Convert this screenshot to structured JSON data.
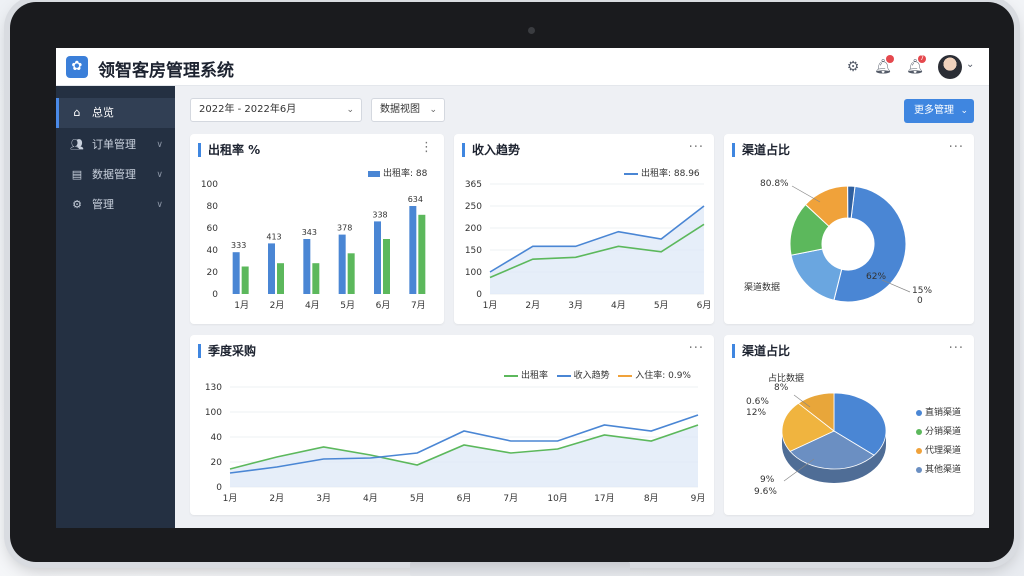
{
  "app": {
    "title": "领智客房管理系统",
    "logo_icon": "tree-logo-icon"
  },
  "topbar": {
    "icons": [
      "settings-icon",
      "bell-icon",
      "notification-icon"
    ],
    "badge_count": "7"
  },
  "sidebar": {
    "items": [
      {
        "label": "总览",
        "icon": "home-icon",
        "active": true
      },
      {
        "label": "订单管理",
        "icon": "users-icon",
        "active": false
      },
      {
        "label": "数据管理",
        "icon": "database-icon",
        "active": false
      },
      {
        "label": "管理",
        "icon": "gear-icon",
        "active": false
      }
    ]
  },
  "filters": {
    "date_range": "2022年 - 2022年6月",
    "view_select": "数据视图",
    "primary_button": "更多管理"
  },
  "cards": {
    "occupancy": {
      "title": "出租率 %",
      "legend": "出租率: 88"
    },
    "revenue": {
      "title": "收入趋势",
      "legend": "出租率: 88.96"
    },
    "channel_top": {
      "title": "渠道占比",
      "label_a": "80.8%",
      "label_b": "62%",
      "label_c": "15%",
      "label_c2": "0",
      "label_d": "渠道数据"
    },
    "quarterly": {
      "title": "季度采购",
      "legend_a": "出租率",
      "legend_b": "收入趋势",
      "legend_c": "入住率: 0.9%"
    },
    "channel_bottom": {
      "title": "渠道占比",
      "label_a": "占比数据",
      "label_a2": "8%",
      "label_b": "0.6%",
      "label_b2": "12%",
      "label_c": "9%",
      "label_c2": "9.6%",
      "legend": [
        "直销渠道",
        "分销渠道",
        "代理渠道",
        "其他渠道"
      ]
    }
  },
  "colors": {
    "blue": "#4a86d4",
    "green": "#5cb85c",
    "orange": "#f0a23a",
    "steel": "#6b8fc2",
    "accent": "#3f86e0"
  },
  "chart_data": [
    {
      "type": "bar",
      "title": "出租率 %",
      "categories": [
        "1月",
        "2月",
        "4月",
        "5月",
        "6月",
        "7月"
      ],
      "yticks": [
        "0",
        "20",
        "40",
        "60",
        "80",
        "100"
      ],
      "ylim": [
        0,
        100
      ],
      "series": [
        {
          "name": "出租率",
          "color": "#4a86d4",
          "values": [
            38,
            46,
            50,
            54,
            66,
            80
          ]
        },
        {
          "values": [
            25,
            28,
            28,
            37,
            50,
            72
          ],
          "color": "#5cb85c"
        }
      ],
      "data_labels": [
        "333",
        "413",
        "343",
        "378",
        "338",
        "634"
      ]
    },
    {
      "type": "area",
      "title": "收入趋势",
      "categories": [
        "1月",
        "2月",
        "3月",
        "4月",
        "5月",
        "6月"
      ],
      "yticks": [
        "0",
        "100",
        "150",
        "200",
        "250",
        "365"
      ],
      "ylim": [
        0,
        6
      ],
      "series": [
        {
          "name": "出租率",
          "color": "#4a86d4",
          "values": [
            1.2,
            2.6,
            2.6,
            3.4,
            3.0,
            4.8
          ]
        },
        {
          "values": [
            0.9,
            1.9,
            2.0,
            2.6,
            2.3,
            3.8
          ],
          "color": "#5cb85c"
        }
      ]
    },
    {
      "type": "pie",
      "title": "渠道占比",
      "slices": [
        {
          "value": 52,
          "color": "#4a86d4"
        },
        {
          "value": 18,
          "color": "#6aa6e0"
        },
        {
          "value": 15,
          "color": "#5cb85c"
        },
        {
          "value": 13,
          "color": "#f0a23a"
        },
        {
          "value": 2,
          "color": "#2f5f9e"
        }
      ]
    },
    {
      "type": "line",
      "title": "季度采购",
      "categories": [
        "1月",
        "2月",
        "3月",
        "4月",
        "5月",
        "6月",
        "7月",
        "10月",
        "17月",
        "8月",
        "9月"
      ],
      "yticks": [
        "0",
        "20",
        "40",
        "100",
        "130"
      ],
      "ylim": [
        0,
        5
      ],
      "series": [
        {
          "name": "出租率",
          "color": "#5cb85c",
          "values": [
            0.9,
            1.5,
            2.0,
            1.6,
            1.1,
            2.1,
            1.7,
            1.9,
            2.6,
            2.3,
            3.1
          ]
        },
        {
          "name": "收入趋势",
          "color": "#4a86d4",
          "values": [
            0.7,
            1.0,
            1.4,
            1.45,
            1.7,
            2.8,
            2.3,
            2.3,
            3.1,
            2.8,
            3.6
          ]
        }
      ]
    },
    {
      "type": "pie",
      "title": "渠道占比",
      "slices": [
        {
          "name": "直销渠道",
          "value": 36,
          "color": "#4a86d4"
        },
        {
          "name": "分销渠道",
          "value": 30,
          "color": "#6b8fc2"
        },
        {
          "name": "代理渠道",
          "value": 22,
          "color": "#f0b43f"
        },
        {
          "name": "其他渠道",
          "value": 12,
          "color": "#e8a63a"
        }
      ]
    }
  ]
}
